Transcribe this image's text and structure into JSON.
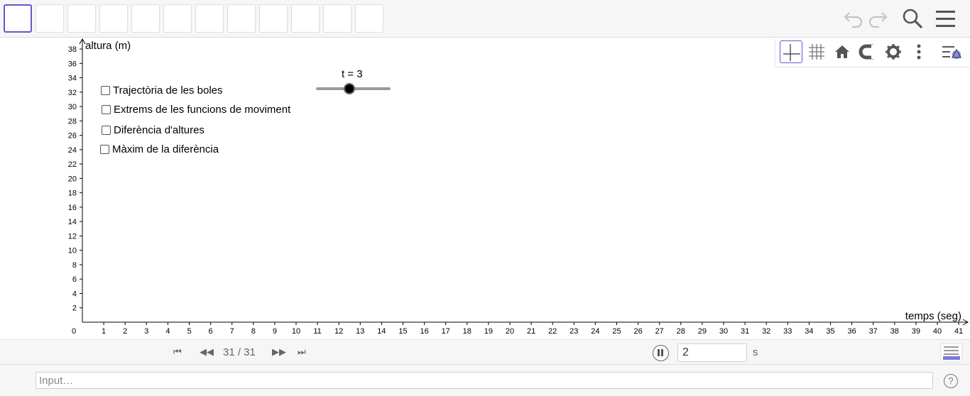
{
  "toolbar": {
    "tool_count": 12,
    "active_tool_index": 0,
    "right_icons": [
      "undo-icon",
      "redo-icon",
      "search-icon",
      "menu-icon"
    ]
  },
  "stylebar": {
    "icons": [
      "axes-icon",
      "grid-icon",
      "home-icon",
      "magnet-icon",
      "gear-icon",
      "more-vertical-icon",
      "graphics-style-icon"
    ]
  },
  "graph": {
    "y_axis_label": "altura (m)",
    "x_axis_label": "temps (seg)",
    "origin_label": "0",
    "x_ticks": [
      1,
      2,
      3,
      4,
      5,
      6,
      7,
      8,
      9,
      10,
      11,
      12,
      13,
      14,
      15,
      16,
      17,
      18,
      19,
      20,
      21,
      22,
      23,
      24,
      25,
      26,
      27,
      28,
      29,
      30,
      31,
      32,
      33,
      34,
      35,
      36,
      37,
      38,
      39,
      40,
      41
    ],
    "y_ticks": [
      2,
      4,
      6,
      8,
      10,
      12,
      14,
      16,
      18,
      20,
      22,
      24,
      26,
      28,
      30,
      32,
      34,
      36,
      38
    ]
  },
  "checkboxes": [
    {
      "label": "Trajectòria de les boles",
      "checked": false
    },
    {
      "label": "Extrems de les funcions de moviment",
      "checked": false
    },
    {
      "label": "Diferència d'altures",
      "checked": false
    },
    {
      "label": "Màxim de la diferència",
      "checked": false
    }
  ],
  "slider": {
    "label": "t = 3",
    "value": 3
  },
  "animbar": {
    "first": "⏮",
    "prev": "◀◀",
    "next": "▶▶",
    "last": "⏭",
    "page_counter": "31 / 31",
    "speed_value": "2",
    "speed_unit": "s"
  },
  "inputbar": {
    "placeholder": "Input…",
    "help": "?"
  },
  "colors": {
    "accent": "#6557d2",
    "toolbar_bg": "#f6f6f6",
    "axis": "#000000"
  }
}
